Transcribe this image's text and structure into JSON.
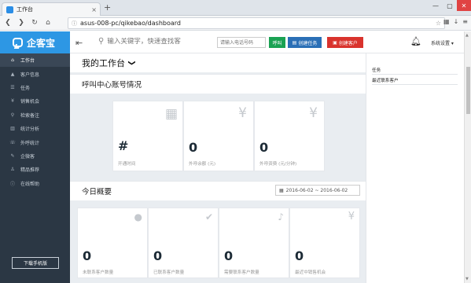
{
  "browser": {
    "tab_title": "工作台",
    "tab_close": "×",
    "new_tab": "+",
    "url": "asus-008-pc/qikebao/dashboard",
    "win_min": "—",
    "win_max": "▢",
    "win_close": "✕"
  },
  "header": {
    "logo_text": "企客宝",
    "search_placeholder": "输入关键字，快速查找客",
    "phone_placeholder": "请输入电话号码",
    "call_label": "呼叫",
    "create_task_label": "创建任务",
    "create_customer_label": "创建客户",
    "settings_label": "系统设置 ▾"
  },
  "sidebar": {
    "items": [
      {
        "icon": "home-icon",
        "glyph": "⌂",
        "label": "工作台"
      },
      {
        "icon": "users-icon",
        "glyph": "👥",
        "label": "客户信息"
      },
      {
        "icon": "tasks-icon",
        "glyph": "☰",
        "label": "任务"
      },
      {
        "icon": "yen-icon",
        "glyph": "¥",
        "label": "销售机会"
      },
      {
        "icon": "search-icon",
        "glyph": "⚲",
        "label": "检索备注"
      },
      {
        "icon": "chart-icon",
        "glyph": "▥",
        "label": "统计分析"
      },
      {
        "icon": "headset-icon",
        "glyph": "☏",
        "label": "外呼统计"
      },
      {
        "icon": "bulb-icon",
        "glyph": "✎",
        "label": "企微客"
      },
      {
        "icon": "thumb-icon",
        "glyph": "♙",
        "label": "精品推荐"
      },
      {
        "icon": "help-icon",
        "glyph": "ⓘ",
        "label": "在线帮助"
      }
    ],
    "download_label": "下载手机版"
  },
  "main": {
    "page_title": "我的工作台",
    "call_center_title": "呼叫中心账号情况",
    "call_cards": [
      {
        "icon": "calendar-icon",
        "glyph": "📅",
        "value": "#",
        "label": "开通时间"
      },
      {
        "icon": "yen-icon",
        "glyph": "¥",
        "value": "0",
        "label": "外呼余额 (元)"
      },
      {
        "icon": "yen-icon",
        "glyph": "¥",
        "value": "0",
        "label": "外呼资费 (元/分钟)"
      }
    ],
    "today_title": "今日概要",
    "date_range": "2016-06-02 ~ 2016-06-02",
    "today_cards": [
      {
        "icon": "user-icon",
        "glyph": "👤",
        "value": "0",
        "label": "未联系客户数量"
      },
      {
        "icon": "check-icon",
        "glyph": "✔",
        "value": "0",
        "label": "已联系客户数量"
      },
      {
        "icon": "bell-icon",
        "glyph": "🔔",
        "value": "0",
        "label": "需要联系客户数量"
      },
      {
        "icon": "yen-icon",
        "glyph": "¥",
        "value": "0",
        "label": "最近中销售机会"
      }
    ]
  },
  "right_panel": {
    "tasks_label": "任务",
    "recent_contacts_label": "最近联系客户"
  }
}
